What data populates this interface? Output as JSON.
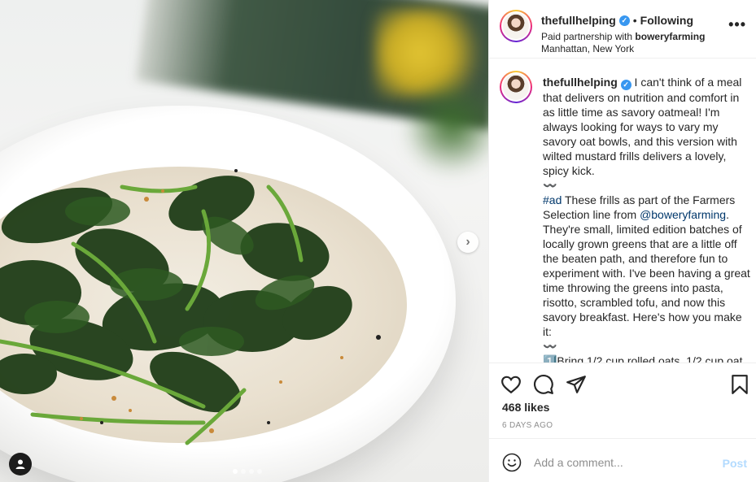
{
  "post": {
    "username": "thefullhelping",
    "follow_separator": "•",
    "follow_status": "Following",
    "partnership_prefix": "Paid partnership with ",
    "partner": "boweryfarming",
    "location": "Manhattan, New York",
    "more_label": "•••"
  },
  "caption": {
    "username": "thefullhelping",
    "para1": "I can't think of a meal that delivers on nutrition and comfort in as little time as savory oatmeal! I'm always looking for ways to vary my savory oat bowls, and this version with wilted mustard frills delivers a lovely, spicy kick.",
    "squiggle1": "〰️",
    "hashtag": "#ad",
    "para2a": " These frills as part of the Farmers Selection line from ",
    "mention": "@boweryfarming",
    "para2b": ". They're small, limited edition batches of locally grown greens that are a little off the beaten path, and therefore fun to experiment with. I've been having a great time throwing the greens into pasta, risotto, scrambled tofu, and now this savory breakfast. Here's how you make it:",
    "squiggle2": "〰️",
    "step1": "1️⃣Bring 1/2 cup rolled oats, 1/2 cup oat"
  },
  "stats": {
    "likes": "468 likes",
    "time": "6 DAYS AGO"
  },
  "comment": {
    "placeholder": "Add a comment...",
    "post_label": "Post"
  },
  "carousel": {
    "next_label": "›",
    "slides": 4,
    "active_index": 0
  },
  "colors": {
    "link": "#00376b",
    "verified": "#3897f0",
    "post_disabled": "#b3dbff",
    "muted": "#8e8e8e"
  },
  "icons": [
    "heart-icon",
    "comment-icon",
    "share-icon",
    "bookmark-icon",
    "emoji-icon",
    "user-tag-icon",
    "chevron-right-icon",
    "verified-icon"
  ]
}
